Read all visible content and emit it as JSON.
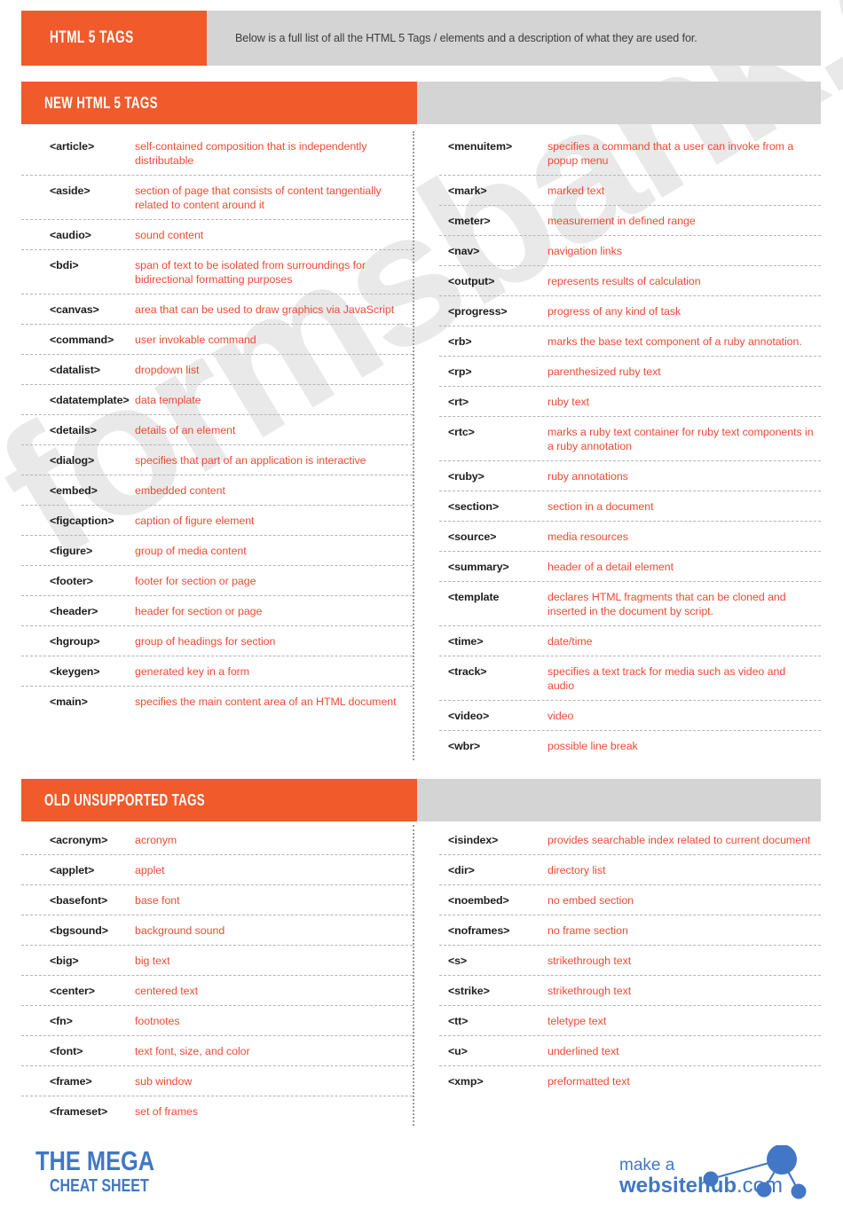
{
  "watermark": {
    "text": "formsbank.com"
  },
  "colors": {
    "orange": "#f15a2b",
    "gray_bar": "#d4d4d4",
    "desc_red": "#ee4b36",
    "tag_black": "#1d1d1d",
    "logo_blue": "#4177c4"
  },
  "header": {
    "badge": "HTML 5 TAGS",
    "description": "Below is a full list of all the HTML  5 Tags / elements and a description of what they are used for."
  },
  "sections": [
    {
      "title": "NEW HTML 5 TAGS",
      "left": [
        {
          "tag": "<article>",
          "desc": "self-contained composition that is independently distributable"
        },
        {
          "tag": "<aside>",
          "desc": "section of page that consists of content tangentially related to content around it"
        },
        {
          "tag": "<audio>",
          "desc": "sound content"
        },
        {
          "tag": "<bdi>",
          "desc": "span of text to be isolated from surroundings for bidirectional formatting purposes"
        },
        {
          "tag": "<canvas>",
          "desc": "area that can be used to draw graphics via JavaScript"
        },
        {
          "tag": "<command>",
          "desc": "user invokable command"
        },
        {
          "tag": "<datalist>",
          "desc": "dropdown list"
        },
        {
          "tag": "<datatemplate>",
          "desc": "data template"
        },
        {
          "tag": "<details>",
          "desc": "details of an element"
        },
        {
          "tag": "<dialog>",
          "desc": "specifies that part of an application is interactive"
        },
        {
          "tag": "<embed>",
          "desc": "embedded content"
        },
        {
          "tag": "<figcaption>",
          "desc": "caption of figure element"
        },
        {
          "tag": "<figure>",
          "desc": "group of media content"
        },
        {
          "tag": "<footer>",
          "desc": "footer for section or page"
        },
        {
          "tag": "<header>",
          "desc": "header for section or page"
        },
        {
          "tag": "<hgroup>",
          "desc": "group of headings for section"
        },
        {
          "tag": "<keygen>",
          "desc": "generated key in a form"
        },
        {
          "tag": "<main>",
          "desc": "specifies the main content area of an HTML document"
        }
      ],
      "right": [
        {
          "tag": "<menuitem>",
          "desc": "specifies a command that a user can invoke from a popup menu"
        },
        {
          "tag": "<mark>",
          "desc": "marked text"
        },
        {
          "tag": "<meter>",
          "desc": "measurement in defined range"
        },
        {
          "tag": "<nav>",
          "desc": "navigation links"
        },
        {
          "tag": "<output>",
          "desc": "represents results of calculation"
        },
        {
          "tag": "<progress>",
          "desc": "progress of any kind of task"
        },
        {
          "tag": "<rb>",
          "desc": "marks the base text component of a ruby annotation."
        },
        {
          "tag": "<rp>",
          "desc": "parenthesized ruby text"
        },
        {
          "tag": "<rt>",
          "desc": "ruby text"
        },
        {
          "tag": "<rtc>",
          "desc": "marks a ruby text container for ruby text components in a ruby annotation"
        },
        {
          "tag": "<ruby>",
          "desc": "ruby annotations"
        },
        {
          "tag": "<section>",
          "desc": "section in a document"
        },
        {
          "tag": "<source>",
          "desc": "media resources"
        },
        {
          "tag": "<summary>",
          "desc": "header of a detail element"
        },
        {
          "tag": "<template",
          "desc": "declares HTML fragments that can be cloned and inserted in the document by script."
        },
        {
          "tag": "<time>",
          "desc": "date/time"
        },
        {
          "tag": "<track>",
          "desc": "specifies a text track for media such as video and audio"
        },
        {
          "tag": "<video>",
          "desc": "video"
        },
        {
          "tag": "<wbr>",
          "desc": "possible line break"
        }
      ]
    },
    {
      "title": "OLD UNSUPPORTED TAGS",
      "left": [
        {
          "tag": "<acronym>",
          "desc": "acronym"
        },
        {
          "tag": "<applet>",
          "desc": "applet"
        },
        {
          "tag": "<basefont>",
          "desc": "base font"
        },
        {
          "tag": "<bgsound>",
          "desc": "background sound"
        },
        {
          "tag": "<big>",
          "desc": "big text"
        },
        {
          "tag": "<center>",
          "desc": "centered text"
        },
        {
          "tag": "<fn>",
          "desc": "footnotes"
        },
        {
          "tag": "<font>",
          "desc": "text font, size, and color"
        },
        {
          "tag": "<frame>",
          "desc": "sub window"
        },
        {
          "tag": "<frameset>",
          "desc": "set of frames"
        }
      ],
      "right": [
        {
          "tag": "<isindex>",
          "desc": "provides searchable index related to current document"
        },
        {
          "tag": "<dir>",
          "desc": "directory list"
        },
        {
          "tag": "<noembed>",
          "desc": "no embed section"
        },
        {
          "tag": "<noframes>",
          "desc": "no frame section"
        },
        {
          "tag": "<s>",
          "desc": "strikethrough text"
        },
        {
          "tag": "<strike>",
          "desc": "strikethrough text"
        },
        {
          "tag": "<tt>",
          "desc": "teletype text"
        },
        {
          "tag": "<u>",
          "desc": "underlined text"
        },
        {
          "tag": "<xmp>",
          "desc": "preformatted text"
        }
      ]
    }
  ],
  "footer": {
    "mega_line1": "THE MEGA",
    "mega_line2": "CHEAT SHEET",
    "hub_line1": "make a",
    "hub_line2_bold": "websitehub",
    "hub_line2_rest": ".com"
  }
}
